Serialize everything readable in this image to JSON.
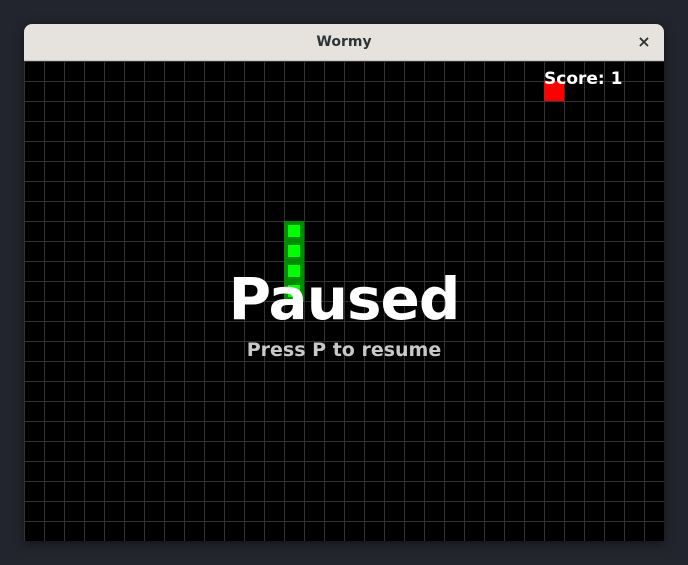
{
  "window": {
    "title": "Wormy",
    "close_glyph": "×"
  },
  "game": {
    "score_text": "Score: 1",
    "paused_title": "Paused",
    "resume_hint": "Press P to resume",
    "colors": {
      "background": "#000000",
      "grid": "#333333",
      "worm_outer": "#008c00",
      "worm_inner": "#00ff00",
      "apple": "#ff0000",
      "text": "#ffffff",
      "hint_text": "#c8c8c8"
    }
  }
}
